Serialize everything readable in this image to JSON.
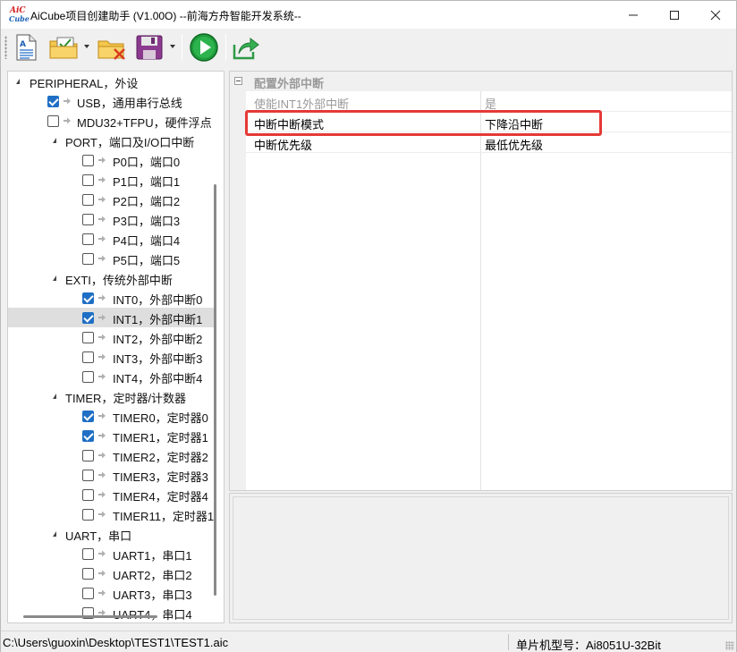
{
  "window": {
    "title": "AiCube项目创建助手 (V1.00O) --前海方舟智能开发系统--",
    "logo_top": "AiC",
    "logo_bottom": "Cube"
  },
  "toolbar": {
    "buttons": [
      "new-project-icon",
      "open-project-icon",
      "close-project-icon",
      "save-project-icon",
      "generate-run-icon",
      "export-icon"
    ]
  },
  "tree": {
    "items": [
      {
        "label": "PERIPHERAL，外设",
        "level": 0,
        "expander": "open"
      },
      {
        "label": "USB，通用串行总线",
        "level": 1,
        "checked": true
      },
      {
        "label": "MDU32+TFPU，硬件浮点",
        "level": 1,
        "checked": false
      },
      {
        "label": "PORT，端口及I/O口中断",
        "level": 1,
        "expander": "open"
      },
      {
        "label": "P0口，端口0",
        "level": 2,
        "checked": false
      },
      {
        "label": "P1口，端口1",
        "level": 2,
        "checked": false
      },
      {
        "label": "P2口，端口2",
        "level": 2,
        "checked": false
      },
      {
        "label": "P3口，端口3",
        "level": 2,
        "checked": false
      },
      {
        "label": "P4口，端口4",
        "level": 2,
        "checked": false
      },
      {
        "label": "P5口，端口5",
        "level": 2,
        "checked": false
      },
      {
        "label": "EXTI，传统外部中断",
        "level": 1,
        "expander": "open"
      },
      {
        "label": "INT0，外部中断0",
        "level": 2,
        "checked": true
      },
      {
        "label": "INT1，外部中断1",
        "level": 2,
        "checked": true,
        "selected": true
      },
      {
        "label": "INT2，外部中断2",
        "level": 2,
        "checked": false
      },
      {
        "label": "INT3，外部中断3",
        "level": 2,
        "checked": false
      },
      {
        "label": "INT4，外部中断4",
        "level": 2,
        "checked": false
      },
      {
        "label": "TIMER，定时器/计数器",
        "level": 1,
        "expander": "open"
      },
      {
        "label": "TIMER0，定时器0",
        "level": 2,
        "checked": true
      },
      {
        "label": "TIMER1，定时器1",
        "level": 2,
        "checked": true
      },
      {
        "label": "TIMER2，定时器2",
        "level": 2,
        "checked": false
      },
      {
        "label": "TIMER3，定时器3",
        "level": 2,
        "checked": false
      },
      {
        "label": "TIMER4，定时器4",
        "level": 2,
        "checked": false
      },
      {
        "label": "TIMER11，定时器11",
        "level": 2,
        "checked": false
      },
      {
        "label": "UART，串口",
        "level": 1,
        "expander": "open"
      },
      {
        "label": "UART1，串口1",
        "level": 2,
        "checked": false
      },
      {
        "label": "UART2，串口2",
        "level": 2,
        "checked": false
      },
      {
        "label": "UART3，串口3",
        "level": 2,
        "checked": false
      },
      {
        "label": "UART4，串口4",
        "level": 2,
        "checked": false
      }
    ]
  },
  "properties": {
    "category": "配置外部中断",
    "rows": [
      {
        "name": "使能INT1外部中断",
        "value": "是",
        "disabled": true
      },
      {
        "name": "中断中断模式",
        "value": "下降沿中断",
        "highlighted": true
      },
      {
        "name": "中断优先级",
        "value": "最低优先级"
      }
    ]
  },
  "description": {
    "text": ""
  },
  "status": {
    "path": "C:\\Users\\guoxin\\Desktop\\TEST1\\TEST1.aic",
    "chip": "单片机型号：Ai8051U-32Bit"
  },
  "colors": {
    "accent": "#1f6fc5",
    "highlight": "#e53935",
    "disabled_text": "#9a9a9a"
  }
}
